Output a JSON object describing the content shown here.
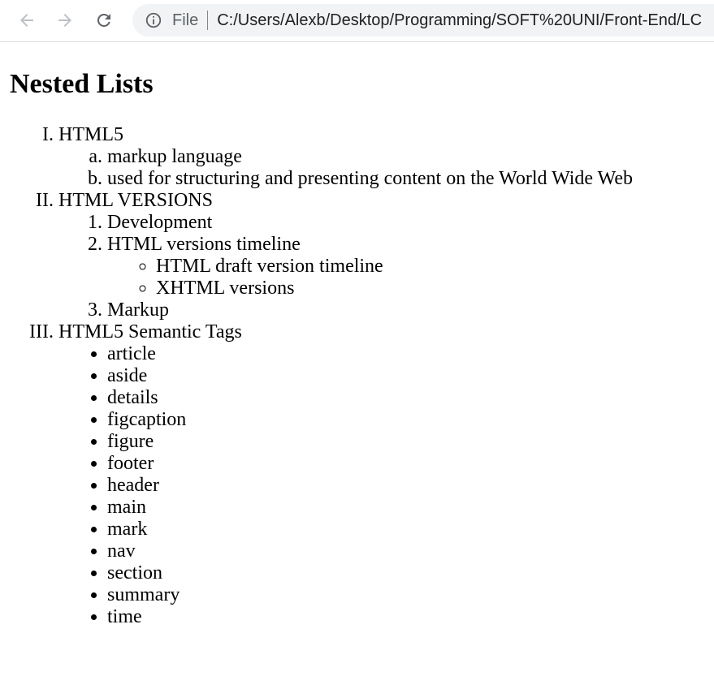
{
  "browser": {
    "back_icon": "arrow-left-icon",
    "forward_icon": "arrow-right-icon",
    "reload_icon": "reload-icon",
    "info_icon": "info-circle-icon",
    "scheme_label": "File",
    "url": "C:/Users/Alexb/Desktop/Programming/SOFT%20UNI/Front-End/LC"
  },
  "page": {
    "title": "Nested Lists",
    "sections": [
      {
        "label": "HTML5",
        "items": [
          "markup language",
          "used for structuring and presenting content on the World Wide Web"
        ]
      },
      {
        "label": "HTML VERSIONS",
        "items": [
          "Development",
          "HTML versions timeline",
          "Markup"
        ],
        "sub_items": [
          "HTML draft version timeline",
          "XHTML versions"
        ]
      },
      {
        "label": "HTML5 Semantic Tags",
        "items": [
          "article",
          "aside",
          "details",
          "figcaption",
          "figure",
          "footer",
          "header",
          "main",
          "mark",
          "nav",
          "section",
          "summary",
          "time"
        ]
      }
    ]
  },
  "colors": {
    "toolbar_bg": "#ffffff",
    "omnibox_bg": "#f1f3f4",
    "icon": "#5f6368"
  }
}
